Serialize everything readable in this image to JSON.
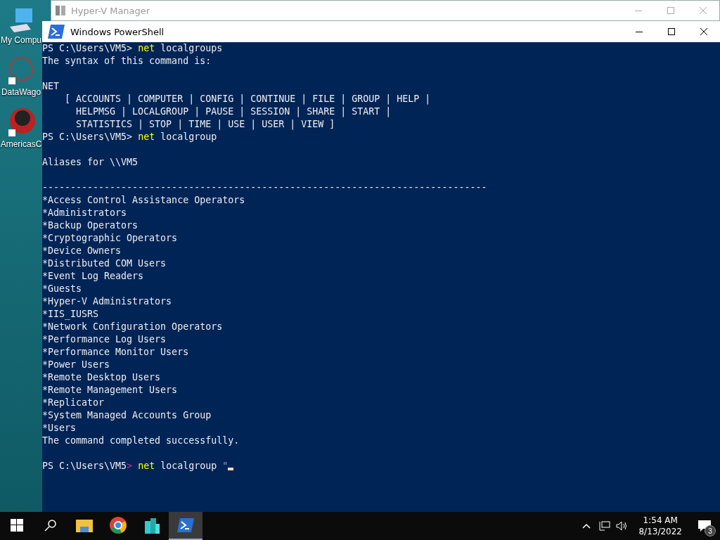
{
  "desktop_icons": [
    {
      "label": "My Compu",
      "kind": "computer"
    },
    {
      "label": "DataWago",
      "kind": "network"
    },
    {
      "label": "AmericasC",
      "kind": "chip"
    }
  ],
  "background_window": {
    "title": "Hyper-V Manager"
  },
  "window": {
    "title": "Windows PowerShell"
  },
  "console": [
    {
      "kind": "prompt",
      "prompt": "PS C:\\Users\\VM5",
      "arrow": ">",
      "arrow_highlighted": false,
      "command": "net",
      "args": "localgroups"
    },
    {
      "kind": "output",
      "text": "The syntax of this command is:"
    },
    {
      "kind": "blank"
    },
    {
      "kind": "output",
      "text": "NET"
    },
    {
      "kind": "output",
      "text": "    [ ACCOUNTS | COMPUTER | CONFIG | CONTINUE | FILE | GROUP | HELP |"
    },
    {
      "kind": "output",
      "text": "      HELPMSG | LOCALGROUP | PAUSE | SESSION | SHARE | START |"
    },
    {
      "kind": "output",
      "text": "      STATISTICS | STOP | TIME | USE | USER | VIEW ]"
    },
    {
      "kind": "prompt",
      "prompt": "PS C:\\Users\\VM5",
      "arrow": ">",
      "arrow_highlighted": false,
      "command": "net",
      "args": "localgroup"
    },
    {
      "kind": "blank"
    },
    {
      "kind": "output",
      "text": "Aliases for \\\\VM5"
    },
    {
      "kind": "blank"
    },
    {
      "kind": "output",
      "text": "-------------------------------------------------------------------------------"
    },
    {
      "kind": "output",
      "text": "*Access Control Assistance Operators"
    },
    {
      "kind": "output",
      "text": "*Administrators"
    },
    {
      "kind": "output",
      "text": "*Backup Operators"
    },
    {
      "kind": "output",
      "text": "*Cryptographic Operators"
    },
    {
      "kind": "output",
      "text": "*Device Owners"
    },
    {
      "kind": "output",
      "text": "*Distributed COM Users"
    },
    {
      "kind": "output",
      "text": "*Event Log Readers"
    },
    {
      "kind": "output",
      "text": "*Guests"
    },
    {
      "kind": "output",
      "text": "*Hyper-V Administrators"
    },
    {
      "kind": "output",
      "text": "*IIS_IUSRS"
    },
    {
      "kind": "output",
      "text": "*Network Configuration Operators"
    },
    {
      "kind": "output",
      "text": "*Performance Log Users"
    },
    {
      "kind": "output",
      "text": "*Performance Monitor Users"
    },
    {
      "kind": "output",
      "text": "*Power Users"
    },
    {
      "kind": "output",
      "text": "*Remote Desktop Users"
    },
    {
      "kind": "output",
      "text": "*Remote Management Users"
    },
    {
      "kind": "output",
      "text": "*Replicator"
    },
    {
      "kind": "output",
      "text": "*System Managed Accounts Group"
    },
    {
      "kind": "output",
      "text": "*Users"
    },
    {
      "kind": "output",
      "text": "The command completed successfully."
    },
    {
      "kind": "blank"
    },
    {
      "kind": "prompt",
      "prompt": "PS C:\\Users\\VM5",
      "arrow": ">",
      "arrow_highlighted": true,
      "command": "net",
      "args": "localgroup",
      "string": "\"",
      "cursor": true
    }
  ],
  "taskbar": {
    "apps": [
      {
        "kind": "explorer",
        "selected": false
      },
      {
        "kind": "chrome",
        "selected": false
      },
      {
        "kind": "buildings",
        "selected": false
      },
      {
        "kind": "powershell",
        "selected": true
      }
    ],
    "time": "1:54 AM",
    "date": "8/13/2022",
    "notifications": "3"
  }
}
